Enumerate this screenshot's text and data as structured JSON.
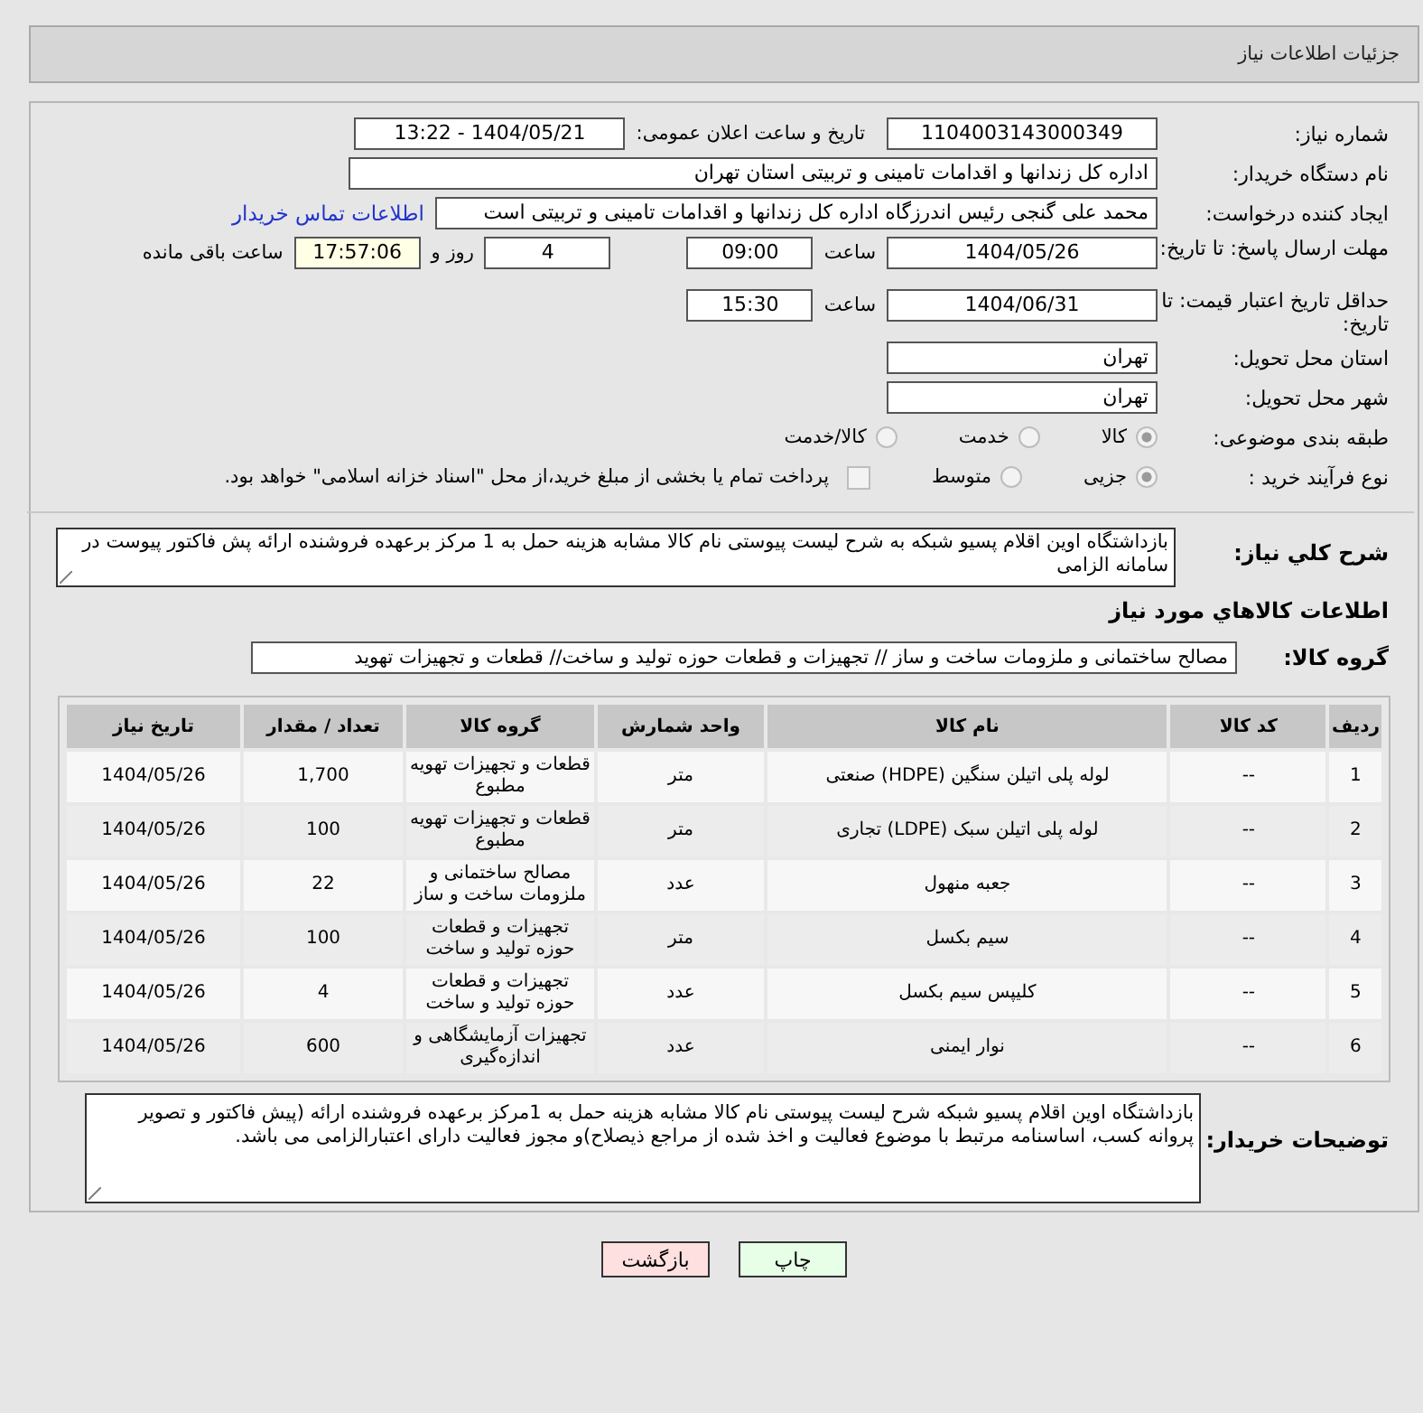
{
  "header": {
    "title": "جزئیات اطلاعات نیاز"
  },
  "form": {
    "need_number": {
      "label": "شماره نیاز:",
      "value": "1104003143000349"
    },
    "announce": {
      "label": "تاریخ و ساعت اعلان عمومی:",
      "value": "1404/05/21 - 13:22"
    },
    "buyer": {
      "label": "نام دستگاه خریدار:",
      "value": "اداره کل زندانها و اقدامات تامینی و تربیتی استان تهران"
    },
    "creator": {
      "label": "ایجاد کننده درخواست:",
      "value": "محمد علی گنجی رئیس اندرزگاه  اداره کل زندانها و اقدامات تامینی و تربیتی است",
      "link": "اطلاعات تماس خریدار"
    },
    "deadline": {
      "label": "مهلت ارسال پاسخ: تا تاریخ:",
      "date": "1404/05/26",
      "time_label": "ساعت",
      "time": "09:00",
      "days": "4",
      "days_label": "روز و",
      "remaining": "17:57:06",
      "remaining_label": "ساعت باقی مانده"
    },
    "validity": {
      "label": "حداقل تاریخ اعتبار قیمت: تا تاریخ:",
      "date": "1404/06/31",
      "time_label": "ساعت",
      "time": "15:30"
    },
    "province": {
      "label": "استان محل تحویل:",
      "value": "تهران"
    },
    "city": {
      "label": "شهر محل تحویل:",
      "value": "تهران"
    },
    "category": {
      "label": "طبقه بندی موضوعی:",
      "options": [
        {
          "label": "کالا",
          "selected": true
        },
        {
          "label": "خدمت",
          "selected": false
        },
        {
          "label": "کالا/خدمت",
          "selected": false
        }
      ]
    },
    "process": {
      "label": "نوع فرآیند خرید :",
      "options": [
        {
          "label": "جزیی",
          "selected": true
        },
        {
          "label": "متوسط",
          "selected": false
        }
      ],
      "treasury": {
        "label": "پرداخت تمام یا بخشی از مبلغ خرید،از محل \"اسناد خزانه اسلامی\" خواهد بود.",
        "checked": false
      }
    }
  },
  "description": {
    "label": "شرح کلي نياز:",
    "value": "بازداشتگاه اوین اقلام پسیو شبکه به شرح لیست پیوستی نام کالا مشابه هزینه حمل به 1 مرکز برعهده فروشنده ارائه پش فاکتور پیوست در سامانه الزامی"
  },
  "goods_heading": "اطلاعات کالاهاي مورد نياز",
  "goods_group": {
    "label": "گروه کالا:",
    "value": "مصالح ساختمانی و ملزومات ساخت و ساز // تجهیزات و قطعات حوزه تولید و ساخت//  قطعات و تجهیزات تهوید"
  },
  "table": {
    "columns": [
      "ردیف",
      "کد کالا",
      "نام کالا",
      "واحد شمارش",
      "گروه کالا",
      "تعداد / مقدار",
      "تاریخ نیاز"
    ],
    "rows": [
      [
        "1",
        "--",
        "لوله پلی اتیلن سنگین (HDPE) صنعتی",
        "متر",
        "قطعات و تجهیزات تهویه مطبوع",
        "1,700",
        "1404/05/26"
      ],
      [
        "2",
        "--",
        "لوله پلی اتیلن سبک (LDPE) تجاری",
        "متر",
        "قطعات و تجهیزات تهویه مطبوع",
        "100",
        "1404/05/26"
      ],
      [
        "3",
        "--",
        "جعبه منهول",
        "عدد",
        "مصالح ساختمانی و ملزومات ساخت و ساز",
        "22",
        "1404/05/26"
      ],
      [
        "4",
        "--",
        "سیم بکسل",
        "متر",
        "تجهیزات و قطعات حوزه تولید و ساخت",
        "100",
        "1404/05/26"
      ],
      [
        "5",
        "--",
        "کلیپس سیم بکسل",
        "عدد",
        "تجهیزات و قطعات حوزه تولید و ساخت",
        "4",
        "1404/05/26"
      ],
      [
        "6",
        "--",
        "نوار ایمنی",
        "عدد",
        "تجهیزات آزمایشگاهی و اندازه‌گیری",
        "600",
        "1404/05/26"
      ]
    ]
  },
  "buyer_notes": {
    "label": "توضیحات خریدار:",
    "value": "بازداشتگاه اوین اقلام پسیو شبکه شرح لیست پیوستی نام کالا مشابه هزینه حمل به 1مرکز برعهده فروشنده ارائه (پیش فاکتور و  تصویر پروانه کسب، اساسنامه مرتبط با موضوع فعالیت و اخذ شده از مراجع ذیصلاح)و مجوز فعالیت دارای اعتبارالزامی می باشد."
  },
  "buttons": [
    {
      "kind": "print",
      "label": "چاپ"
    },
    {
      "kind": "back",
      "label": "بازگشت"
    }
  ]
}
